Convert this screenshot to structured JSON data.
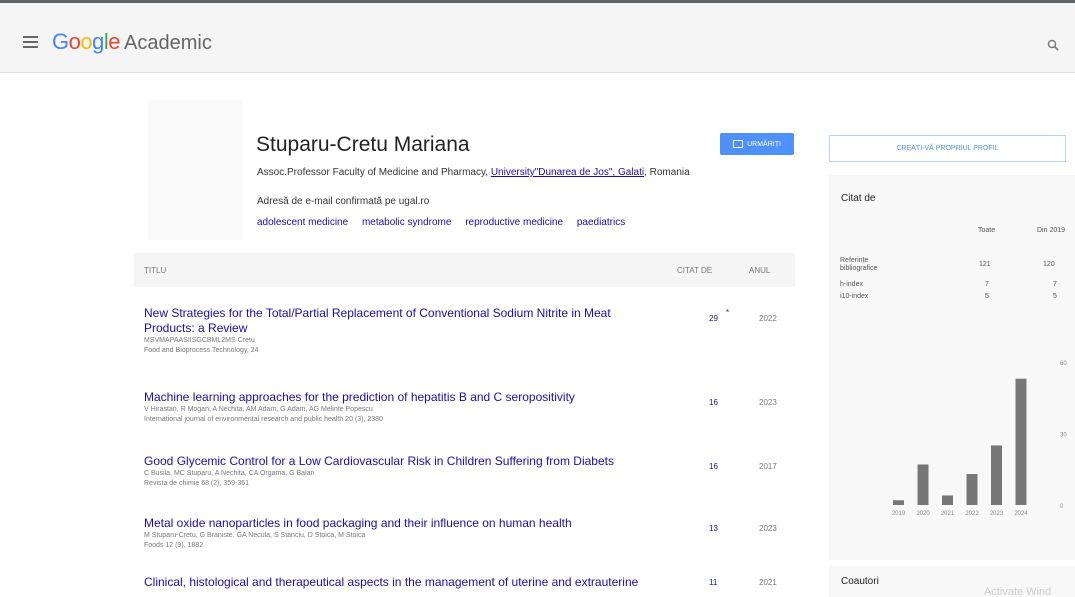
{
  "header": {
    "logo_word": "Google",
    "logo_suffix": "Academic"
  },
  "profile": {
    "name": "Stuparu-Cretu Mariana",
    "affiliation_prefix": "Assoc.Professor Faculty of Medicine and Pharmacy, ",
    "affiliation_link": "University\"Dunarea de Jos\", Galati",
    "affiliation_suffix": ", Romania",
    "email_text": "Adresă de e-mail confirmată pe ugal.ro",
    "interests": [
      "adolescent medicine",
      "metabolic syndrome",
      "reproductive medicine",
      "paediatrics"
    ],
    "follow_label": "URMĂRIȚI"
  },
  "table": {
    "col_title": "TITLU",
    "col_cited": "CITAT DE",
    "col_year": "ANUL",
    "rows": [
      {
        "title": "New Strategies for the Total/Partial Replacement of Conventional Sodium Nitrite in Meat Products: a Review",
        "authors": "MSVMAPAASIISGCBML2MS Cretu",
        "venue": "Food and Bioprocess Technology, 24",
        "cited": "29",
        "star": "*",
        "year": "2022"
      },
      {
        "title": "Machine learning approaches for the prediction of hepatitis B and C seropositivity",
        "authors": "V Hirastan, R Mogan, A Nechita, AM Adam, G Adam, AG Melinte Popescu",
        "venue": "International journal of environmental research and public health 20 (3), 2380",
        "cited": "16",
        "star": "",
        "year": "2023"
      },
      {
        "title": "Good Glycemic Control for a Low Cardiovascular Risk in Children Suffering from Diabets",
        "authors": "C Busila, MC Stuparu, A Nechita, CA Orgama, G Balan",
        "venue": "Revista de chimie 68 (2), 359-361",
        "cited": "16",
        "star": "",
        "year": "2017"
      },
      {
        "title": "Metal oxide nanoparticles in food packaging and their influence on human health",
        "authors": "M Stuparu-Cretu, G Braniste, GA Necula, S Stanciu, D Stoica, M Stoica",
        "venue": "Foods 12 (9), 1882",
        "cited": "13",
        "star": "",
        "year": "2023"
      },
      {
        "title": "Clinical, histological and therapeutical aspects in the management of uterine and extrauterine",
        "authors": "",
        "venue": "",
        "cited": "11",
        "star": "",
        "year": "2021"
      }
    ]
  },
  "sidebar": {
    "create_profile": "CREAȚI-VĂ PROPRIUL PROFIL",
    "cited_by_title": "Citat de",
    "col_all": "Toate",
    "col_since": "Din 2019",
    "stats": [
      {
        "label": "Referințe bibliografice",
        "all": "121",
        "since": "120"
      },
      {
        "label": "h-index",
        "all": "7",
        "since": "7"
      },
      {
        "label": "i10-index",
        "all": "5",
        "since": "5"
      }
    ],
    "coauthors_title": "Coautori"
  },
  "chart_data": {
    "type": "bar",
    "categories": [
      "2019",
      "2020",
      "2021",
      "2022",
      "2023",
      "2024"
    ],
    "values": [
      2,
      17,
      4,
      13,
      25,
      53
    ],
    "title": "",
    "xlabel": "",
    "ylabel": "",
    "ylim": [
      0,
      60
    ],
    "yticks": [
      "60",
      "30",
      "0"
    ],
    "grid": false,
    "color": "#777777"
  },
  "watermark": "Activate Wind",
  "colors": {
    "link": "#1a0dab",
    "accent": "#4d90fe",
    "header_bg": "#f5f5f5"
  }
}
